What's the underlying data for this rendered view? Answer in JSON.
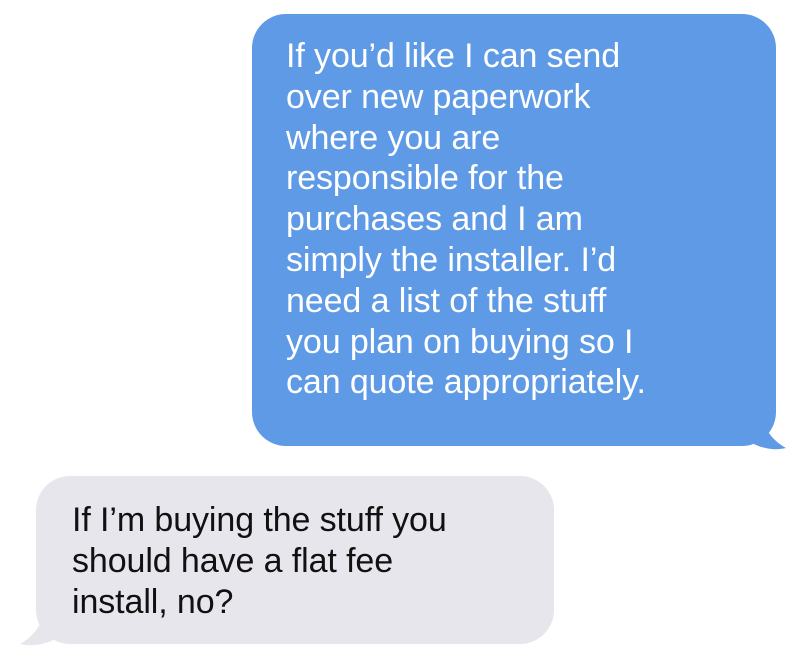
{
  "conversation": {
    "messages": [
      {
        "direction": "sent",
        "text": "If you’d like I can send\nover new paperwork\nwhere you are\nresponsible for the\npurchases and I am\nsimply the installer. I’d\nneed a list of the stuff\nyou plan on buying so I\ncan quote appropriately."
      },
      {
        "direction": "received",
        "text": "If I’m buying the stuff you\nshould have a flat fee\ninstall, no?"
      }
    ]
  },
  "colors": {
    "sent_bubble": "#5f9ae6",
    "sent_text": "#ffffff",
    "received_bubble": "#e6e6ec",
    "received_text": "#111111",
    "background": "#ffffff"
  }
}
